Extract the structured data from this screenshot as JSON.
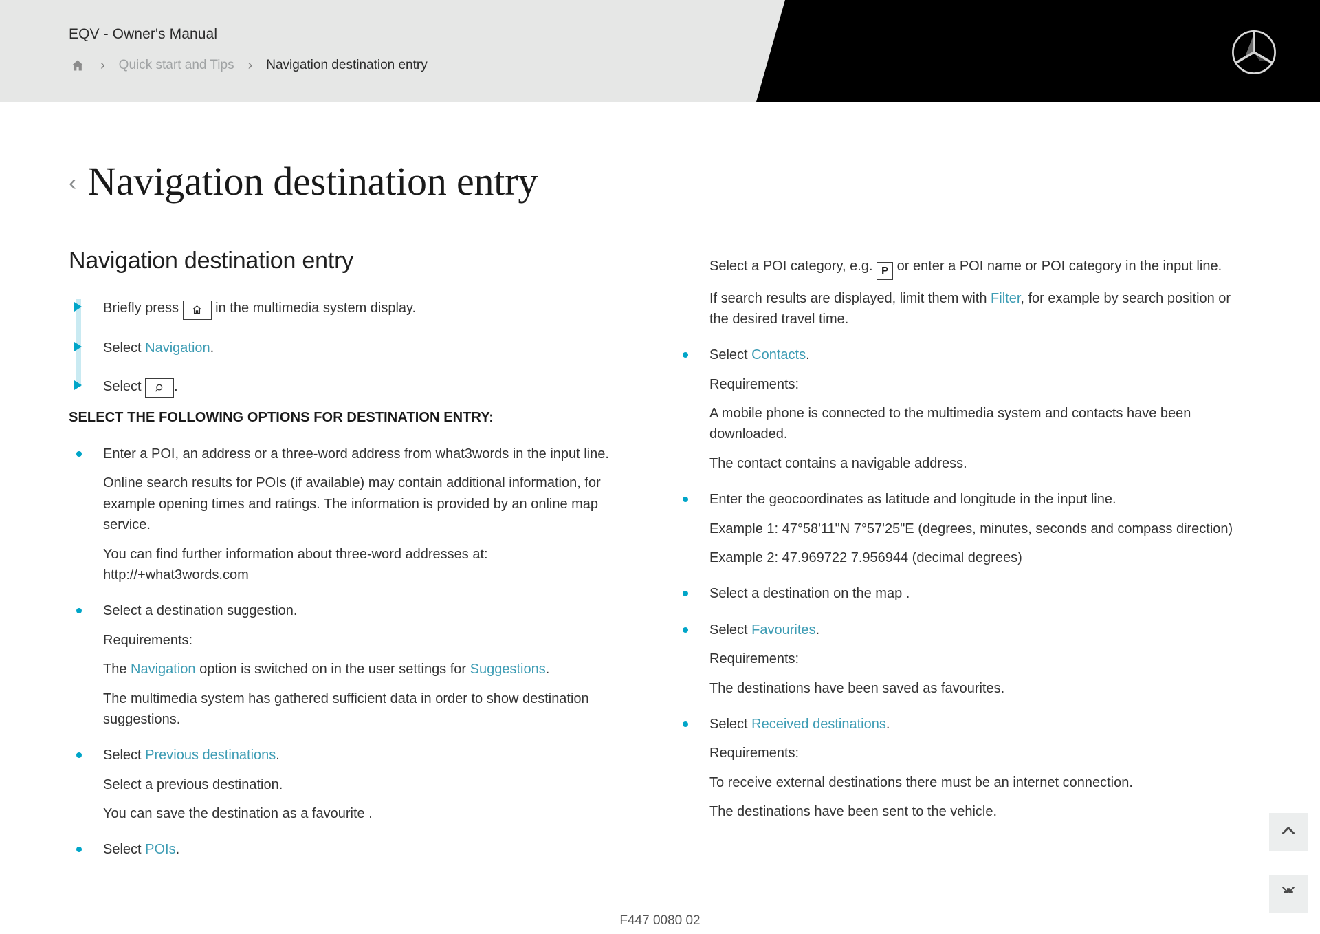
{
  "header": {
    "manual_title": "EQV - Owner's Manual",
    "home_icon": "home-icon",
    "separator": "›",
    "breadcrumb": [
      {
        "label": "Quick start and Tips",
        "current": false
      },
      {
        "label": "Navigation destination entry",
        "current": true
      }
    ],
    "brand_logo": "mercedes-benz-star-logo"
  },
  "page": {
    "back_chevron": "‹",
    "title": "Navigation destination entry"
  },
  "left_column": {
    "section_heading": "Navigation destination entry",
    "steps": [
      {
        "before": "Briefly press ",
        "icon": "home-key-icon",
        "after": " in the multimedia system display."
      },
      {
        "before": "Select ",
        "link": "Navigation",
        "after": "."
      },
      {
        "before": "Select ",
        "icon": "search-key-icon",
        "after": "."
      }
    ],
    "subheading": "SELECT THE FOLLOWING OPTIONS FOR DESTINATION ENTRY:",
    "options": [
      {
        "paragraphs": [
          "Enter a POI, an address or a three-word address from what3words in the input line.",
          "Online search results for POIs (if available) may contain additional information, for example opening times and ratings. The information is provided by an online map service.",
          "You can find further information about three-word addresses at: http://+what3words.com"
        ]
      },
      {
        "lead_prefix": "Select a destination suggestion.",
        "paragraphs": [
          "Requirements:",
          "The multimedia system has gathered sufficient data in order to show destination suggestions."
        ],
        "req_line_prefix": "The ",
        "req_link_1": "Navigation",
        "req_line_middle": " option is switched on in the user settings for ",
        "req_link_2": "Suggestions",
        "req_line_suffix": "."
      },
      {
        "lead_prefix": "Select ",
        "lead_link": "Previous destinations",
        "lead_suffix": ".",
        "paragraphs": [
          "Select a previous destination.",
          "You can save the destination as a favourite ."
        ]
      },
      {
        "lead_prefix": "Select ",
        "lead_link": "POIs",
        "lead_suffix": ".",
        "paragraphs": []
      }
    ]
  },
  "right_column": {
    "poi_intro": {
      "before": "Select a POI category, e.g. ",
      "icon_letter": "P",
      "after": " or enter a POI name or POI category in the input line."
    },
    "filter_line": {
      "before": "If search results are displayed, limit them with ",
      "link": "Filter",
      "after": ", for example by search position or the desired travel time."
    },
    "options": [
      {
        "lead_prefix": "Select ",
        "lead_link": "Contacts",
        "lead_suffix": ".",
        "paragraphs": [
          "Requirements:",
          "A mobile phone is connected to the multimedia system and contacts have been downloaded.",
          "The contact contains a navigable address."
        ]
      },
      {
        "lead_plain": "Enter the geocoordinates as latitude and longitude in the input line.",
        "paragraphs": [
          "Example 1: 47°58'11\"N 7°57'25\"E (degrees, minutes, seconds and compass direction)",
          "Example 2: 47.969722 7.956944 (decimal degrees)"
        ]
      },
      {
        "lead_plain": "Select a destination on the map .",
        "paragraphs": []
      },
      {
        "lead_prefix": "Select ",
        "lead_link": "Favourites",
        "lead_suffix": ".",
        "paragraphs": [
          "Requirements:",
          "The destinations have been saved as favourites."
        ]
      },
      {
        "lead_prefix": "Select ",
        "lead_link": "Received destinations",
        "lead_suffix": ".",
        "paragraphs": [
          "Requirements:",
          "To receive external destinations there must be an internet connection.",
          "The destinations have been sent to the vehicle."
        ]
      }
    ]
  },
  "floating_buttons": [
    {
      "name": "scroll-to-top-button",
      "icon": "chevron-up-icon"
    },
    {
      "name": "collapse-button",
      "icon": "collapse-arrows-icon"
    }
  ],
  "footer": {
    "document_code": "F447 0080 02"
  },
  "colors": {
    "accent_teal": "#3d9cb4",
    "bullet_cyan": "#00a5c8",
    "rail_light_blue": "#c9eaf2",
    "header_grey": "#e6e7e6",
    "header_black": "#000000"
  }
}
